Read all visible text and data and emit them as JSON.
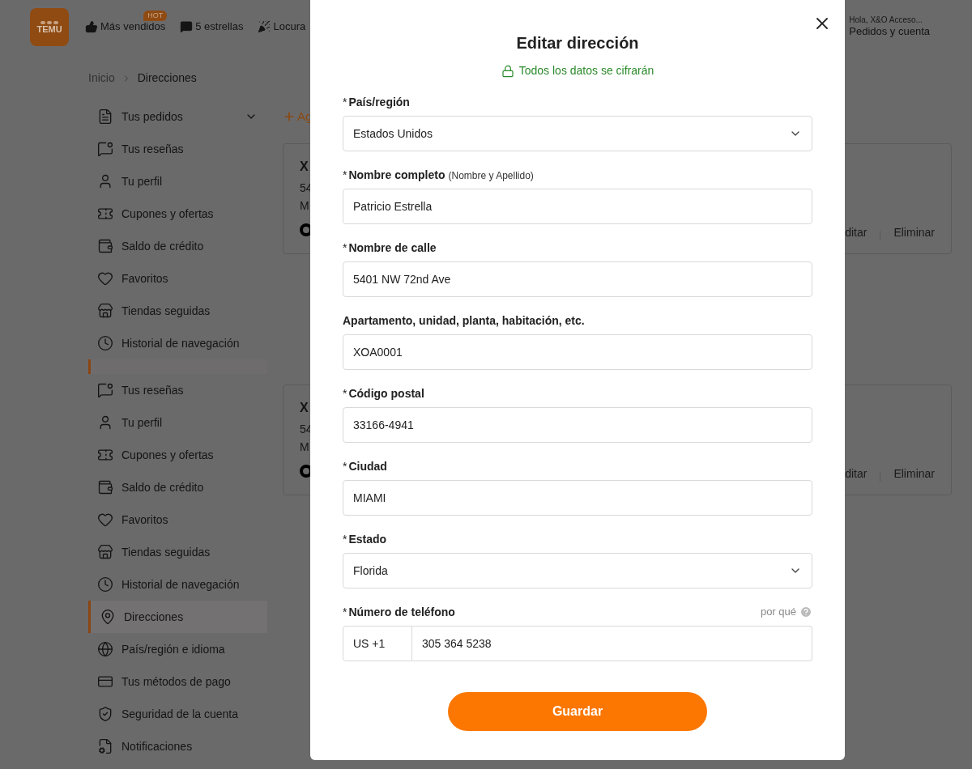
{
  "header": {
    "logo": "TEMU",
    "nav": [
      {
        "kind": "bestsellers",
        "label": "Más vendidos",
        "badge": "HOT"
      },
      {
        "kind": "stars",
        "label": "5 estrellas"
      },
      {
        "kind": "party",
        "label": "Locura"
      }
    ],
    "account": {
      "greeting": "Hola, X&O Acceso...",
      "label": "Pedidos y cuenta"
    }
  },
  "breadcrumb": [
    "Inicio",
    "Direcciones"
  ],
  "sidebar": {
    "groups": [
      {
        "items": [
          {
            "kind": "orders",
            "label": "Tus pedidos",
            "selected": false,
            "expanded": false
          },
          {
            "kind": "reviews",
            "label": "Tus reseñas",
            "selected": false
          },
          {
            "kind": "profile",
            "label": "Tu perfil",
            "selected": false
          },
          {
            "kind": "coupons",
            "label": "Cupones y ofertas",
            "selected": false
          },
          {
            "kind": "credit",
            "label": "Saldo de crédito",
            "selected": false
          },
          {
            "kind": "favorites",
            "label": "Favoritos",
            "selected": false
          },
          {
            "kind": "stores",
            "label": "Tiendas seguidas",
            "selected": false
          },
          {
            "kind": "history",
            "label": "Historial de navegación",
            "selected": false
          }
        ]
      },
      {
        "items": [
          {
            "kind": "reviews",
            "label": "Tus reseñas",
            "selected": false
          },
          {
            "kind": "profile",
            "label": "Tu perfil",
            "selected": false
          },
          {
            "kind": "coupons",
            "label": "Cupones y ofertas",
            "selected": false
          },
          {
            "kind": "credit",
            "label": "Saldo de crédito",
            "selected": false
          },
          {
            "kind": "favorites",
            "label": "Favoritos",
            "selected": false
          },
          {
            "kind": "stores",
            "label": "Tiendas seguidas",
            "selected": false
          },
          {
            "kind": "history",
            "label": "Historial de navegación",
            "selected": false
          },
          {
            "kind": "addresses",
            "label": "Direcciones",
            "selected": true
          },
          {
            "kind": "language",
            "label": "País/región e idioma",
            "selected": false
          },
          {
            "kind": "payment",
            "label": "Tus métodos de pago",
            "selected": false
          },
          {
            "kind": "security",
            "label": "Seguridad de la cuenta",
            "selected": false
          },
          {
            "kind": "notifications",
            "label": "Notificaciones",
            "selected": false
          }
        ]
      }
    ]
  },
  "addresses": {
    "add_button": "Ag",
    "cards": [
      {
        "name": "X",
        "line_1": "54",
        "line_2": "M",
        "actions": [
          "ditar",
          "Eliminar"
        ]
      },
      {
        "name": "X",
        "line_1": "54",
        "line_2": "M",
        "actions": [
          "ditar",
          "Eliminar"
        ]
      }
    ]
  },
  "dialog": {
    "title": "Editar dirección",
    "notice": "Todos los datos se cifrarán",
    "fields": [
      {
        "kind": "select",
        "mark": "*",
        "label": "País/región",
        "value": "Estados Unidos"
      },
      {
        "kind": "text",
        "mark": "*",
        "label": "Nombre completo",
        "hint": "(Nombre y Apellido)",
        "value": "Patricio Estrella"
      },
      {
        "kind": "text",
        "mark": "*",
        "label": "Nombre de calle",
        "value": "5401 NW 72nd Ave"
      },
      {
        "kind": "text",
        "label": "Apartamento, unidad, planta, habitación, etc.",
        "value": "XOA0001"
      },
      {
        "kind": "text",
        "mark": "*",
        "label": "Código postal",
        "value": "33166-4941"
      },
      {
        "kind": "text",
        "mark": "*",
        "label": "Ciudad",
        "value": "MIAMI"
      },
      {
        "kind": "select",
        "mark": "*",
        "label": "Estado",
        "value": "Florida"
      },
      {
        "kind": "phone",
        "mark": "*",
        "label": "Número de teléfono",
        "help": "por qué",
        "prefix": "US +1",
        "value": "305 364 5238"
      }
    ],
    "save_button": "Guardar"
  }
}
